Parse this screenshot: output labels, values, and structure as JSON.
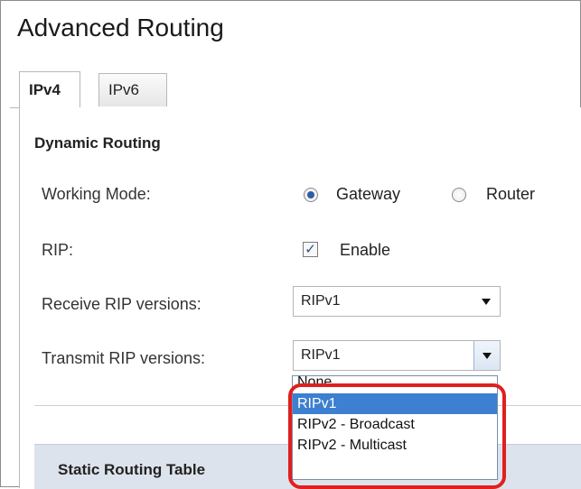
{
  "page": {
    "title": "Advanced Routing"
  },
  "tabs": [
    {
      "label": "IPv4",
      "active": true
    },
    {
      "label": "IPv6",
      "active": false
    }
  ],
  "dynamic_routing": {
    "heading": "Dynamic Routing",
    "working_mode": {
      "label": "Working Mode:",
      "options": [
        "Gateway",
        "Router"
      ],
      "selected": "Gateway"
    },
    "rip": {
      "label": "RIP:",
      "checkbox_label": "Enable",
      "checked": true
    },
    "receive": {
      "label": "Receive RIP versions:",
      "value": "RIPv1"
    },
    "transmit": {
      "label": "Transmit RIP versions:",
      "value": "RIPv1"
    }
  },
  "transmit_dropdown": {
    "options": [
      "None",
      "RIPv1",
      "RIPv2 - Broadcast",
      "RIPv2 - Multicast"
    ],
    "highlighted": "RIPv1"
  },
  "static_routing": {
    "heading": "Static Routing Table"
  },
  "colors": {
    "selection": "#3d7fd0",
    "annotation": "#e01f1f"
  }
}
